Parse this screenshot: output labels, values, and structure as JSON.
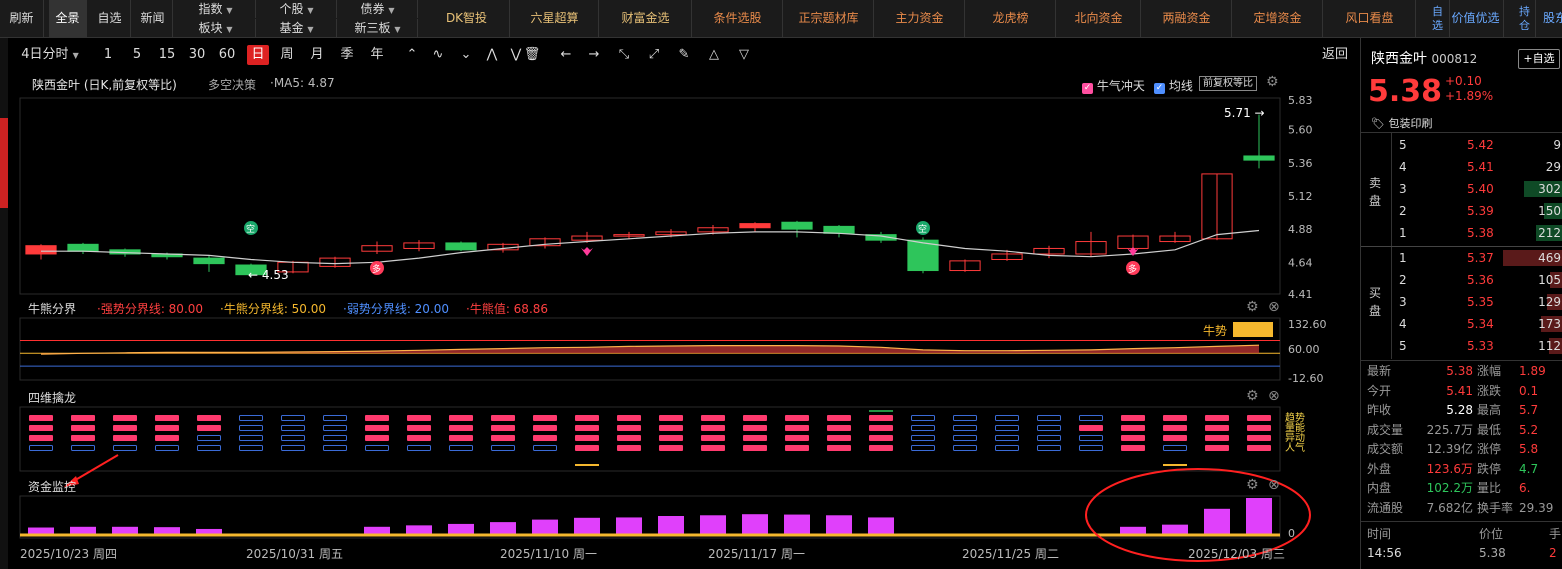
{
  "topbar": {
    "refresh": "刷新",
    "full": "全景",
    "watch": "自选",
    "news": "新闻",
    "index": "指数",
    "sector": "板块",
    "stock": "个股",
    "fund": "基金",
    "bond": "债券",
    "neeq": "新三板",
    "features": [
      "DK智投",
      "六星超算",
      "财富金选"
    ],
    "features2": [
      "条件选股",
      "正宗题材库",
      "主力资金",
      "龙虎榜",
      "北向资金",
      "两融资金",
      "定增资金",
      "风口看盘"
    ],
    "self_label": "自\n选",
    "value_pick": "价值优选",
    "hold_label": "持\n仓",
    "stock_east": "股东"
  },
  "toolbar": {
    "period_4day": "4日分时",
    "periods": [
      "1",
      "5",
      "15",
      "30",
      "60",
      "日",
      "周",
      "月",
      "季",
      "年"
    ],
    "selected_period": "日",
    "back": "返回"
  },
  "kline_panel": {
    "title": "陕西金叶 (日K,前复权等比)",
    "strategy": "多空决策",
    "ma": "·MA5: 4.87",
    "bull_check": "牛气冲天",
    "ma_check": "均线",
    "adjust_btn": "前复权等比",
    "high_label": "5.71 →",
    "low_label": "← 4.53",
    "empty_badge": "空",
    "more_badge": "多"
  },
  "bull_panel": {
    "title": "牛熊分界",
    "strong": "·强势分界线: 80.00",
    "mid": "·牛熊分界线: 50.00",
    "weak": "·弱势分界线: 20.00",
    "value": "·牛熊值: 68.86",
    "state": "牛势"
  },
  "dragon_panel": {
    "title": "四维擒龙",
    "labels": [
      "趋势",
      "量能",
      "异动",
      "人气"
    ]
  },
  "fund_panel": {
    "title": "资金监控"
  },
  "dates": [
    "2025/10/23 周四",
    "2025/10/31 周五",
    "2025/11/10 周一",
    "2025/11/17 周一",
    "2025/11/25 周二",
    "2025/12/03 周三"
  ],
  "chart_data": {
    "type": "candlestick",
    "ylim": [
      4.41,
      5.83
    ],
    "yticks": [
      "5.83",
      "5.60",
      "5.36",
      "5.12",
      "4.88",
      "4.64",
      "4.41"
    ],
    "candles": [
      {
        "o": 4.7,
        "c": 4.76,
        "h": 4.77,
        "l": 4.66
      },
      {
        "o": 4.77,
        "c": 4.72,
        "h": 4.78,
        "l": 4.7
      },
      {
        "o": 4.73,
        "c": 4.7,
        "h": 4.74,
        "l": 4.68
      },
      {
        "o": 4.7,
        "c": 4.68,
        "h": 4.71,
        "l": 4.66
      },
      {
        "o": 4.67,
        "c": 4.63,
        "h": 4.69,
        "l": 4.57
      },
      {
        "o": 4.62,
        "c": 4.55,
        "h": 4.63,
        "l": 4.53
      },
      {
        "o": 4.57,
        "c": 4.64,
        "h": 4.65,
        "l": 4.56
      },
      {
        "o": 4.61,
        "c": 4.67,
        "h": 4.68,
        "l": 4.6
      },
      {
        "o": 4.72,
        "c": 4.76,
        "h": 4.79,
        "l": 4.7
      },
      {
        "o": 4.74,
        "c": 4.78,
        "h": 4.8,
        "l": 4.72
      },
      {
        "o": 4.78,
        "c": 4.73,
        "h": 4.79,
        "l": 4.72
      },
      {
        "o": 4.73,
        "c": 4.77,
        "h": 4.78,
        "l": 4.71
      },
      {
        "o": 4.76,
        "c": 4.81,
        "h": 4.82,
        "l": 4.74
      },
      {
        "o": 4.8,
        "c": 4.83,
        "h": 4.86,
        "l": 4.78
      },
      {
        "o": 4.83,
        "c": 4.84,
        "h": 4.86,
        "l": 4.81
      },
      {
        "o": 4.84,
        "c": 4.86,
        "h": 4.88,
        "l": 4.82
      },
      {
        "o": 4.86,
        "c": 4.89,
        "h": 4.91,
        "l": 4.84
      },
      {
        "o": 4.89,
        "c": 4.92,
        "h": 4.93,
        "l": 4.86
      },
      {
        "o": 4.93,
        "c": 4.88,
        "h": 4.94,
        "l": 4.82
      },
      {
        "o": 4.9,
        "c": 4.85,
        "h": 4.91,
        "l": 4.82
      },
      {
        "o": 4.84,
        "c": 4.8,
        "h": 4.86,
        "l": 4.78
      },
      {
        "o": 4.8,
        "c": 4.58,
        "h": 4.82,
        "l": 4.56
      },
      {
        "o": 4.58,
        "c": 4.65,
        "h": 4.66,
        "l": 4.57
      },
      {
        "o": 4.66,
        "c": 4.7,
        "h": 4.73,
        "l": 4.65
      },
      {
        "o": 4.7,
        "c": 4.74,
        "h": 4.76,
        "l": 4.67
      },
      {
        "o": 4.7,
        "c": 4.79,
        "h": 4.86,
        "l": 4.68
      },
      {
        "o": 4.74,
        "c": 4.83,
        "h": 4.84,
        "l": 4.72
      },
      {
        "o": 4.79,
        "c": 4.83,
        "h": 4.86,
        "l": 4.78
      },
      {
        "o": 4.81,
        "c": 5.28,
        "h": 5.28,
        "l": 4.8
      },
      {
        "o": 5.41,
        "c": 5.38,
        "h": 5.71,
        "l": 5.32
      }
    ],
    "ma5": [
      4.72,
      4.72,
      4.71,
      4.7,
      4.69,
      4.66,
      4.64,
      4.63,
      4.64,
      4.67,
      4.71,
      4.74,
      4.77,
      4.79,
      4.81,
      4.83,
      4.85,
      4.86,
      4.86,
      4.85,
      4.83,
      4.78,
      4.74,
      4.72,
      4.69,
      4.68,
      4.7,
      4.73,
      4.84,
      4.87
    ],
    "bull_values": [
      48,
      50,
      51,
      52,
      52,
      52,
      53,
      54,
      55,
      57,
      59,
      61,
      63,
      64,
      66,
      67,
      68,
      68,
      68,
      67,
      64,
      58,
      56,
      56,
      57,
      58,
      61,
      63,
      66,
      68.86
    ],
    "bull_ylim": [
      -12.6,
      132.6
    ],
    "bull_lines": {
      "strong": 80,
      "mid": 50,
      "weak": 20
    },
    "fund_values": [
      0.18,
      0.2,
      0.2,
      0.19,
      0.14,
      0,
      0,
      0,
      0.2,
      0.24,
      0.28,
      0.33,
      0.4,
      0.45,
      0.46,
      0.5,
      0.52,
      0.55,
      0.54,
      0.52,
      0.46,
      0,
      0,
      0,
      0,
      0,
      0.2,
      0.26,
      0.7,
      1.0
    ],
    "dragon_rows": [
      [
        "r",
        "r",
        "r",
        "r",
        "r",
        "b",
        "b",
        "b",
        "r",
        "r",
        "r",
        "r",
        "r",
        "r",
        "r",
        "r",
        "r",
        "r",
        "r",
        "r",
        "r",
        "b",
        "b",
        "b",
        "b",
        "b",
        "r",
        "r",
        "r",
        "r"
      ],
      [
        "r",
        "r",
        "r",
        "r",
        "r",
        "b",
        "b",
        "b",
        "r",
        "r",
        "r",
        "r",
        "r",
        "r",
        "r",
        "r",
        "r",
        "r",
        "r",
        "r",
        "r",
        "b",
        "b",
        "b",
        "b",
        "r",
        "r",
        "r",
        "r",
        "r"
      ],
      [
        "r",
        "r",
        "r",
        "r",
        "b",
        "b",
        "b",
        "b",
        "r",
        "r",
        "r",
        "r",
        "r",
        "r",
        "r",
        "r",
        "r",
        "r",
        "r",
        "r",
        "r",
        "b",
        "b",
        "b",
        "b",
        "b",
        "r",
        "r",
        "r",
        "r"
      ],
      [
        "b",
        "b",
        "b",
        "b",
        "b",
        "b",
        "b",
        "b",
        "b",
        "b",
        "b",
        "b",
        "b",
        "r",
        "r",
        "r",
        "r",
        "r",
        "r",
        "r",
        "r",
        "b",
        "b",
        "b",
        "b",
        "b",
        "r",
        "b",
        "r",
        "r"
      ]
    ]
  },
  "quote": {
    "name": "陕西金叶",
    "code": "000812",
    "add_btn": "+自选",
    "price": "5.38",
    "change": "+0.10",
    "pct": "+1.89%",
    "tag": "包装印刷",
    "sell_label": "卖\n盘",
    "buy_label": "买\n盘",
    "sells": [
      {
        "lvl": "5",
        "price": "5.42",
        "vol": "9"
      },
      {
        "lvl": "4",
        "price": "5.41",
        "vol": "29"
      },
      {
        "lvl": "3",
        "price": "5.40",
        "vol": "302"
      },
      {
        "lvl": "2",
        "price": "5.39",
        "vol": "150"
      },
      {
        "lvl": "1",
        "price": "5.38",
        "vol": "212"
      }
    ],
    "buys": [
      {
        "lvl": "1",
        "price": "5.37",
        "vol": "469"
      },
      {
        "lvl": "2",
        "price": "5.36",
        "vol": "105"
      },
      {
        "lvl": "3",
        "price": "5.35",
        "vol": "129"
      },
      {
        "lvl": "4",
        "price": "5.34",
        "vol": "173"
      },
      {
        "lvl": "5",
        "price": "5.33",
        "vol": "112"
      }
    ],
    "stats": [
      {
        "k": "最新",
        "v": "5.38",
        "c": "red",
        "k2": "涨幅",
        "v2": "1.89",
        "c2": "red"
      },
      {
        "k": "今开",
        "v": "5.41",
        "c": "red",
        "k2": "涨跌",
        "v2": "0.1",
        "c2": "red"
      },
      {
        "k": "昨收",
        "v": "5.28",
        "c": "white",
        "k2": "最高",
        "v2": "5.7",
        "c2": "red"
      },
      {
        "k": "成交量",
        "v": "225.7万",
        "c": "gray",
        "k2": "最低",
        "v2": "5.2",
        "c2": "red"
      },
      {
        "k": "成交额",
        "v": "12.39亿",
        "c": "gray",
        "k2": "涨停",
        "v2": "5.8",
        "c2": "red"
      },
      {
        "k": "外盘",
        "v": "123.6万",
        "c": "red",
        "k2": "跌停",
        "v2": "4.7",
        "c2": "green"
      },
      {
        "k": "内盘",
        "v": "102.2万",
        "c": "green",
        "k2": "量比",
        "v2": "6.",
        "c2": "red"
      },
      {
        "k": "流通股",
        "v": "7.682亿",
        "c": "gray",
        "k2": "换手率",
        "v2": "29.39",
        "c2": "gray"
      }
    ],
    "tick_head": [
      "时间",
      "价位",
      "手"
    ],
    "tick": {
      "time": "14:56",
      "price": "5.38",
      "vol": "2"
    }
  },
  "colors": {
    "up": "#ff3b3b",
    "down": "#2ec55b",
    "bg": "#000000",
    "magenta": "#e040fb",
    "gold": "#f5b82e",
    "dragon_red": "#ff3a6e",
    "dragon_blue": "#3b6bd6"
  }
}
